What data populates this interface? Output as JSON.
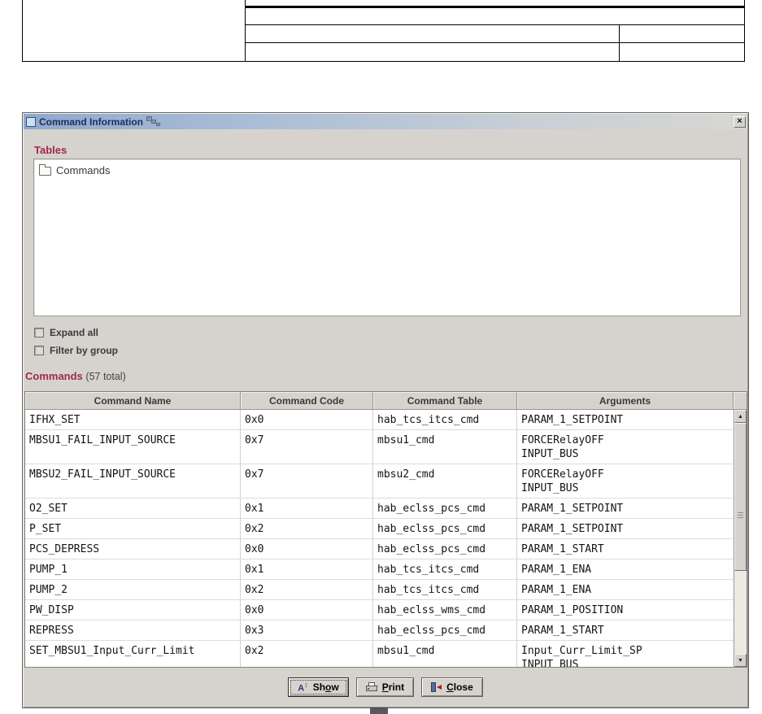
{
  "window": {
    "title": "Command Information",
    "close_glyph": "×"
  },
  "icons": {
    "scroll_up": "▲",
    "scroll_down": "▼",
    "show_letter": "A",
    "show_arrows": "↕"
  },
  "tables_panel": {
    "heading": "Tables",
    "tree": [
      {
        "label": "Commands"
      }
    ],
    "expand_all_label": "Expand all",
    "filter_by_group_label": "Filter by group"
  },
  "commands_panel": {
    "heading": "Commands",
    "count": "(57 total)",
    "columns": [
      "Command Name",
      "Command Code",
      "Command Table",
      "Arguments"
    ],
    "rows": [
      [
        "IFHX_SET",
        "0x0",
        "hab_tcs_itcs_cmd",
        "PARAM_1_SETPOINT"
      ],
      [
        "MBSU1_FAIL_INPUT_SOURCE",
        "0x7",
        "mbsu1_cmd",
        "FORCERelayOFF\nINPUT_BUS"
      ],
      [
        "MBSU2_FAIL_INPUT_SOURCE",
        "0x7",
        "mbsu2_cmd",
        "FORCERelayOFF\nINPUT_BUS"
      ],
      [
        "O2_SET",
        "0x1",
        "hab_eclss_pcs_cmd",
        "PARAM_1_SETPOINT"
      ],
      [
        "P_SET",
        "0x2",
        "hab_eclss_pcs_cmd",
        "PARAM_1_SETPOINT"
      ],
      [
        "PCS_DEPRESS",
        "0x0",
        "hab_eclss_pcs_cmd",
        "PARAM_1_START"
      ],
      [
        "PUMP_1",
        "0x1",
        "hab_tcs_itcs_cmd",
        "PARAM_1_ENA"
      ],
      [
        "PUMP_2",
        "0x2",
        "hab_tcs_itcs_cmd",
        "PARAM_1_ENA"
      ],
      [
        "PW_DISP",
        "0x0",
        "hab_eclss_wms_cmd",
        "PARAM_1_POSITION"
      ],
      [
        "REPRESS",
        "0x3",
        "hab_eclss_pcs_cmd",
        "PARAM_1_START"
      ],
      [
        "SET_MBSU1_Input_Curr_Limit",
        "0x2",
        "mbsu1_cmd",
        "Input_Curr_Limit_SP\nINPUT_BUS"
      ]
    ]
  },
  "buttons": {
    "show": {
      "pre": "Sh",
      "mnemonic": "o",
      "post": "w"
    },
    "print": {
      "pre": "",
      "mnemonic": "P",
      "post": "rint"
    },
    "close": {
      "pre": "",
      "mnemonic": "C",
      "post": "lose"
    }
  }
}
